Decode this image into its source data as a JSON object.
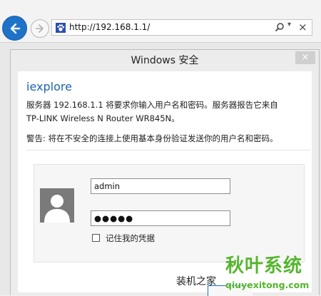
{
  "browser": {
    "address_url": "http://192.168.1.1/",
    "back_icon": "back-arrow-icon",
    "forward_icon": "forward-arrow-icon",
    "favicon_icon": "paw-favicon-icon",
    "search_icon": "search-icon",
    "dropdown_glyph": "▾",
    "close_glyph": "×"
  },
  "dialog": {
    "title": "Windows 安全",
    "close_glyph": "×",
    "app_name": "iexplore",
    "message_line1": "服务器 192.168.1.1 将要求你输入用户名和密码。服务器报告它来自",
    "message_line2": "TP-LINK Wireless N Router WR845N。",
    "warning": "警告: 将在不安全的连接上使用基本身份验证发送你的用户名和密码。",
    "username_value": "admin",
    "password_mask": "●●●●●",
    "remember_label": "记住我的凭据"
  },
  "watermark": {
    "small_text": "装机之家",
    "title": "秋叶系统",
    "url": "qiuyexitong.com",
    "color": "#55b52d"
  }
}
